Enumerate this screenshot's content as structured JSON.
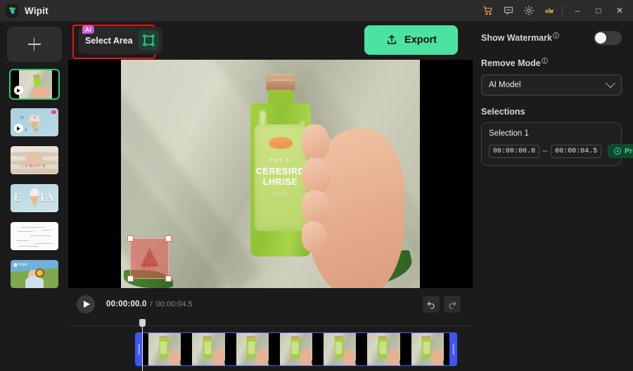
{
  "titlebar": {
    "app_name": "Wipit",
    "logo_icon": "wipit-logo-icon",
    "icons": [
      {
        "name": "cart-icon",
        "color": "#e8a33d"
      },
      {
        "name": "feedback-icon",
        "color": "#b9b9b9"
      },
      {
        "name": "gear-icon",
        "color": "#b9b9b9"
      },
      {
        "name": "vip-avatar-icon",
        "color": "#d7a33c"
      }
    ],
    "window_buttons": [
      {
        "name": "minimize-button",
        "glyph": "–"
      },
      {
        "name": "maximize-button",
        "glyph": "□"
      },
      {
        "name": "close-button",
        "glyph": "✕"
      }
    ]
  },
  "sidebar": {
    "add_button": {
      "name": "add-media-button",
      "icon": "plus-icon"
    },
    "thumbnails": [
      {
        "name": "thumbnail-1",
        "selected": true,
        "has_play": true,
        "caption": ""
      },
      {
        "name": "thumbnail-2",
        "selected": false,
        "has_play": true,
        "caption": "m  d 4. n"
      },
      {
        "name": "thumbnail-3",
        "selected": false,
        "has_play": false,
        "caption": "LEMIITN"
      },
      {
        "name": "thumbnail-4",
        "selected": false,
        "has_play": false,
        "caption_left": "E",
        "caption_right": "TA"
      },
      {
        "name": "thumbnail-5",
        "selected": false,
        "has_play": false,
        "caption": ""
      },
      {
        "name": "thumbnail-6",
        "selected": false,
        "has_play": false,
        "caption": "Wipit"
      }
    ]
  },
  "toolbar": {
    "select_area": {
      "label": "Select Area",
      "badge": "AI",
      "icon": "select-area-frame-icon",
      "highlighted": true,
      "highlight_color": "#ee1111"
    },
    "export": {
      "label": "Export",
      "icon": "export-upload-icon",
      "color": "#4ce2a0"
    }
  },
  "stage": {
    "bottle_label": {
      "small_top": "PHY S",
      "line1": "CERESIRD",
      "line2": "LHRISE",
      "small_bottom": "youe"
    },
    "selection_box": {
      "name": "watermark-selection-box",
      "logo_text": "OXY",
      "fill_color": "#e65a50",
      "handles": 4
    }
  },
  "player": {
    "play_button": "play-icon",
    "current_time": "00:00:00.0",
    "separator": "/",
    "total_time": "00:00:04.5",
    "undo_icon": "undo-arrow-icon",
    "redo_icon": "redo-arrow-icon"
  },
  "timeline": {
    "playhead_icon": "playhead-marker-icon",
    "trim_left": "trim-handle-left",
    "trim_right": "trim-handle-right",
    "frames": [
      "01",
      "02",
      "03",
      "04",
      "05",
      "06",
      "07"
    ]
  },
  "right_panel": {
    "watermark": {
      "label": "Show Watermark",
      "info": "ⓘ",
      "toggle_on": false
    },
    "remove_mode": {
      "label": "Remove Mode",
      "info": "ⓘ",
      "value": "AI Model",
      "chevron": "chevron-down-icon"
    },
    "selections": {
      "heading": "Selections",
      "items": [
        {
          "title": "Selection 1",
          "start": "00:00:00.0",
          "dash": "–",
          "end": "00:00:04.5",
          "preview_label": "Preview",
          "preview_icon": "preview-circle-icon"
        }
      ]
    }
  }
}
